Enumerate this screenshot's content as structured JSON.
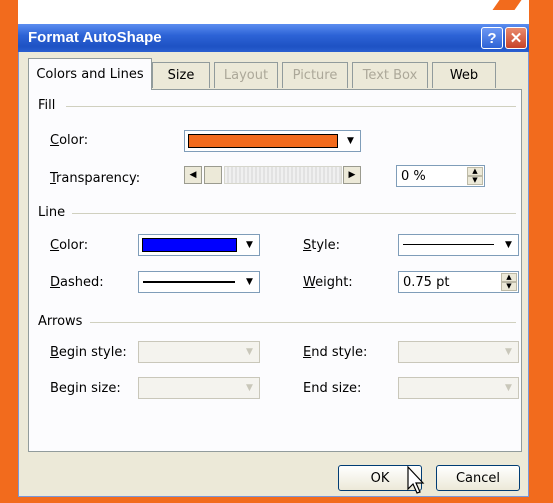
{
  "window": {
    "title": "Format AutoShape",
    "help_label": "?",
    "close_label": "✕"
  },
  "tabs": [
    {
      "label": "Colors and Lines",
      "state": "active"
    },
    {
      "label": "Size",
      "state": "enabled"
    },
    {
      "label": "Layout",
      "state": "disabled"
    },
    {
      "label": "Picture",
      "state": "disabled"
    },
    {
      "label": "Text Box",
      "state": "disabled"
    },
    {
      "label": "Web",
      "state": "enabled"
    }
  ],
  "fill": {
    "group_label": "Fill",
    "color_label": "Color:",
    "color_value": "#f26b1d",
    "transparency_label": "Transparency:",
    "transparency_value": "0 %"
  },
  "line": {
    "group_label": "Line",
    "color_label": "Color:",
    "color_value": "#0000ff",
    "style_label": "Style:",
    "dashed_label": "Dashed:",
    "weight_label": "Weight:",
    "weight_value": "0.75 pt"
  },
  "arrows": {
    "group_label": "Arrows",
    "begin_style_label": "Begin style:",
    "begin_size_label": "Begin size:",
    "end_style_label": "End style:",
    "end_size_label": "End size:"
  },
  "buttons": {
    "ok": "OK",
    "cancel": "Cancel"
  },
  "icons": {
    "dropdown": "▼",
    "slider_left": "◀",
    "slider_right": "▶",
    "spin_up": "▲",
    "spin_down": "▼"
  }
}
